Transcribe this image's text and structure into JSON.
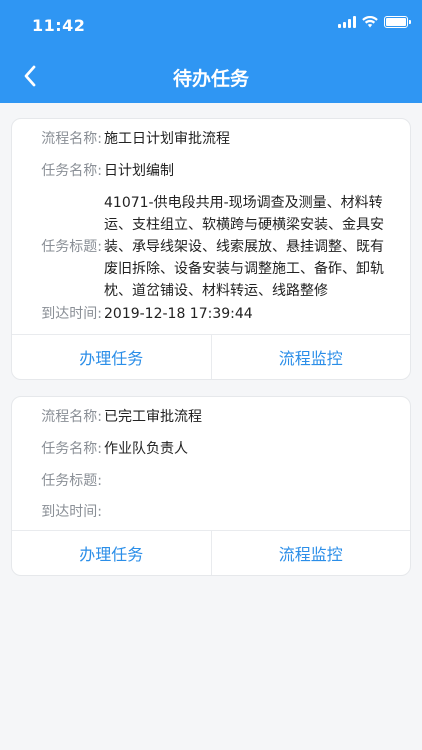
{
  "status_bar": {
    "time": "11:42"
  },
  "header": {
    "title": "待办任务"
  },
  "labels": {
    "process_name": "流程名称:",
    "task_name": "任务名称:",
    "task_title": "任务标题:",
    "arrival_time": "到达时间:"
  },
  "tasks": [
    {
      "process_name": "施工日计划审批流程",
      "task_name": "日计划编制",
      "task_title_lines": [
        "41071-供电段共用-现场调查及测量、材料转",
        "运、支柱组立、软横跨与硬横梁安装、金具安",
        "装、承导线架设、线索展放、悬挂调整、既有",
        "废旧拆除、设备安装与调整施工、备砟、卸轨",
        "枕、道岔铺设、材料转运、线路整修"
      ],
      "arrival_time": "2019-12-18 17:39:44",
      "handle_label": "办理任务",
      "monitor_label": "流程监控"
    },
    {
      "process_name": "已完工审批流程",
      "task_name": "作业队负责人",
      "task_title_lines": [],
      "arrival_time": "",
      "handle_label": "办理任务",
      "monitor_label": "流程监控"
    }
  ],
  "colors": {
    "header_bg": "#2f96f3",
    "action_text": "#2b8ee8",
    "label_text": "#8a8f96",
    "page_bg": "#f5f6f8"
  }
}
